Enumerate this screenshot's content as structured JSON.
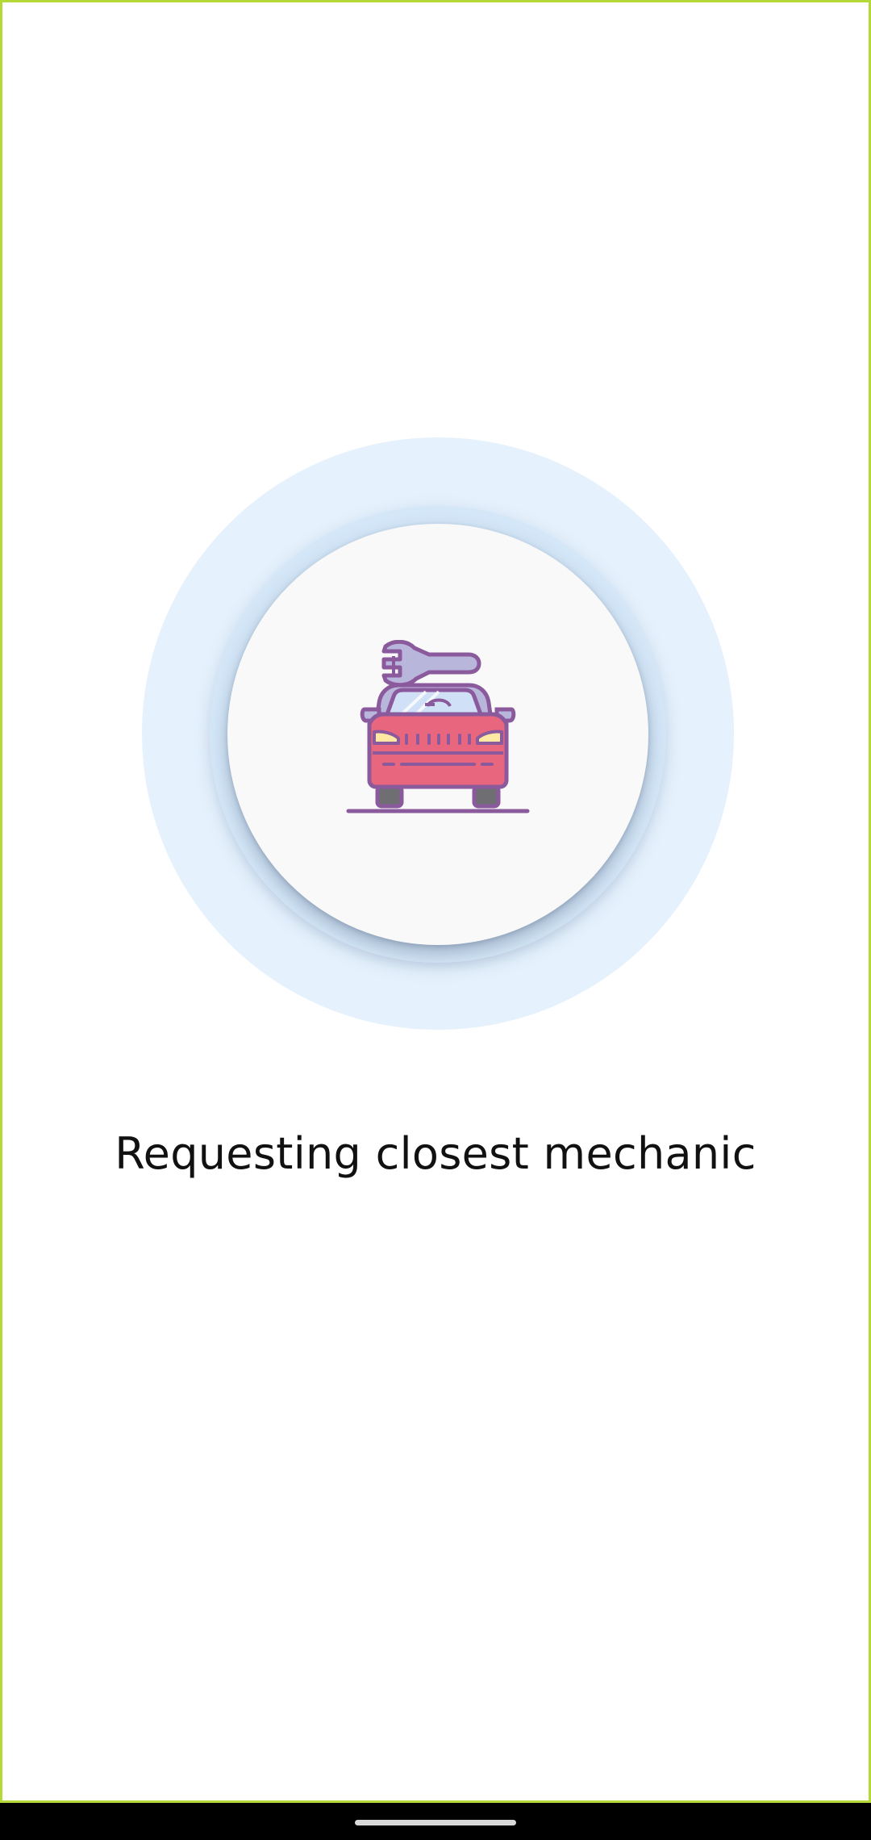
{
  "status": {
    "message": "Requesting closest mechanic"
  },
  "icon": {
    "name": "car-repair-icon"
  },
  "colors": {
    "frame_border": "#b5d936",
    "pulse_outer": "#e5f1fc",
    "pulse_ring": "#d4e7f8",
    "disc": "#f9f9f9",
    "car_body": "#e8667e",
    "car_outline": "#8a5a9c",
    "windshield": "#cfe0f7",
    "wrench": "#b9b6dc",
    "headlight": "#fde9a4",
    "tire": "#6f6f73"
  }
}
